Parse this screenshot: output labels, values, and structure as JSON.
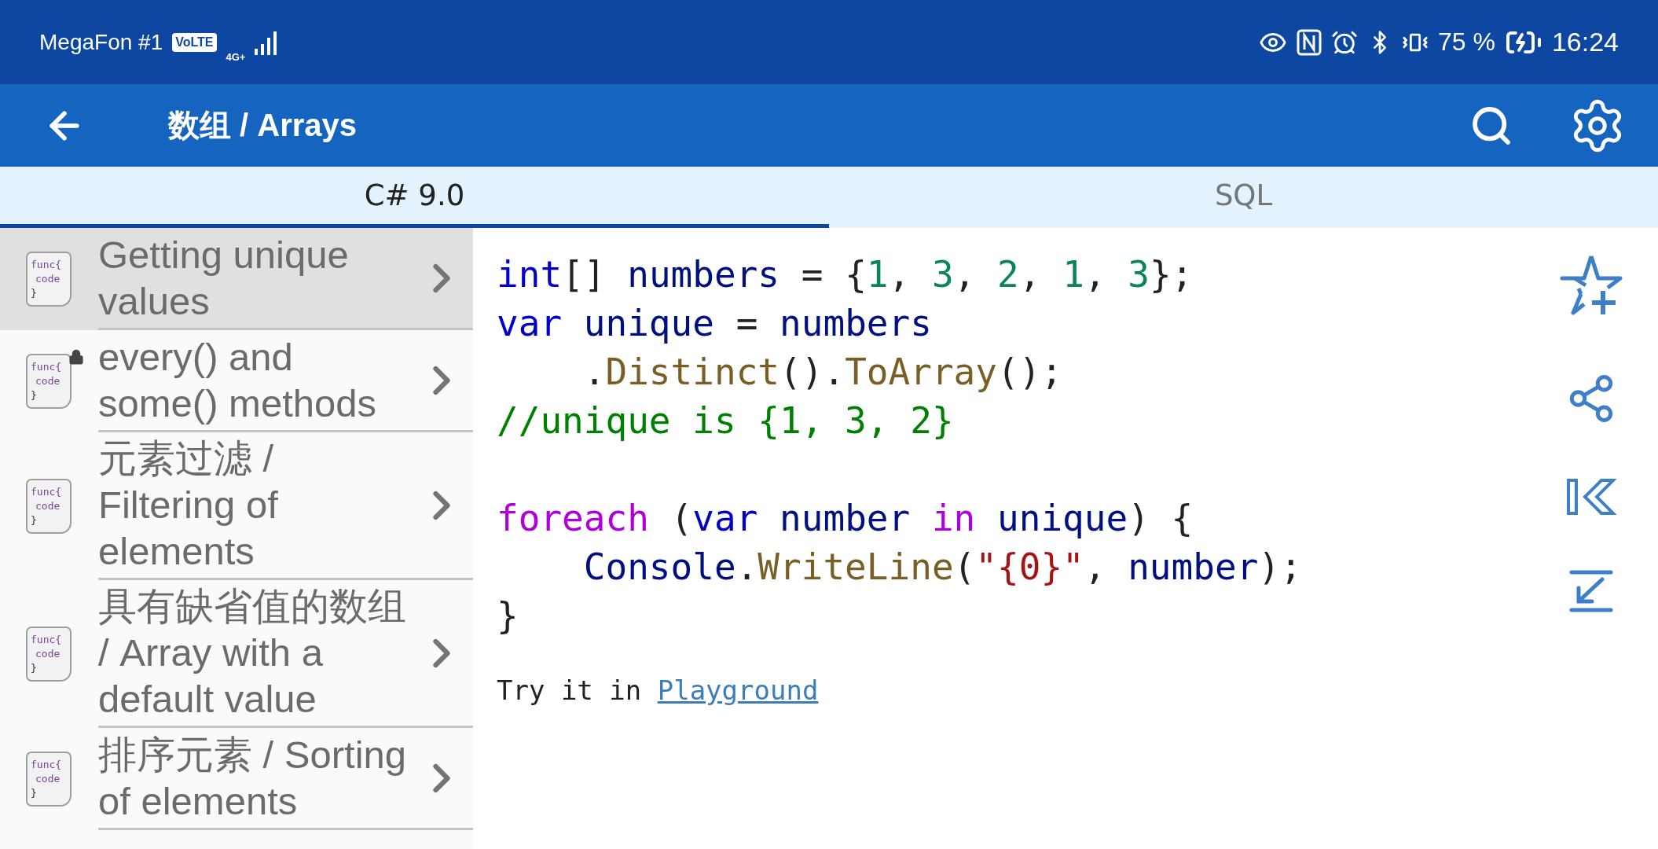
{
  "status_bar": {
    "carrier": "MegaFon #1",
    "volte": "VoLTE",
    "network": "4G+",
    "battery_percent": "75 %",
    "time": "16:24"
  },
  "app_bar": {
    "title": "数组 / Arrays"
  },
  "tabs": [
    {
      "label": "C# 9.0",
      "selected": true
    },
    {
      "label": "SQL",
      "selected": false
    }
  ],
  "topics": [
    {
      "title": "Getting unique values",
      "selected": true,
      "locked": false,
      "icon_lines": [
        "func{",
        "code",
        "}"
      ]
    },
    {
      "title": "every() and some() methods",
      "selected": false,
      "locked": true,
      "icon_lines": [
        "func{",
        "code",
        "}"
      ]
    },
    {
      "title": "元素过滤 / Filtering of elements",
      "selected": false,
      "locked": false,
      "icon_lines": [
        "func{",
        "code",
        "}"
      ]
    },
    {
      "title": "具有缺省值的数组 / Array with a default value",
      "selected": false,
      "locked": false,
      "icon_lines": [
        "func{",
        "code",
        "}"
      ]
    },
    {
      "title": "排序元素 / Sorting of elements",
      "selected": false,
      "locked": false,
      "icon_lines": [
        "func{",
        "code",
        "}"
      ]
    }
  ],
  "code": [
    {
      "indented": false,
      "gap_before": false,
      "tokens": [
        {
          "kind": "keyword",
          "text": "int"
        },
        {
          "kind": "plain",
          "text": "[] "
        },
        {
          "kind": "variable",
          "text": "numbers"
        },
        {
          "kind": "plain",
          "text": " = {"
        },
        {
          "kind": "number",
          "text": "1"
        },
        {
          "kind": "plain",
          "text": ", "
        },
        {
          "kind": "number",
          "text": "3"
        },
        {
          "kind": "plain",
          "text": ", "
        },
        {
          "kind": "number",
          "text": "2"
        },
        {
          "kind": "plain",
          "text": ", "
        },
        {
          "kind": "number",
          "text": "1"
        },
        {
          "kind": "plain",
          "text": ", "
        },
        {
          "kind": "number",
          "text": "3"
        },
        {
          "kind": "plain",
          "text": "};"
        }
      ]
    },
    {
      "indented": false,
      "gap_before": false,
      "tokens": [
        {
          "kind": "keyword",
          "text": "var"
        },
        {
          "kind": "variable",
          "text": " unique"
        },
        {
          "kind": "plain",
          "text": " = "
        },
        {
          "kind": "variable",
          "text": "numbers"
        }
      ]
    },
    {
      "indented": true,
      "gap_before": false,
      "tokens": [
        {
          "kind": "plain",
          "text": "."
        },
        {
          "kind": "method",
          "text": "Distinct"
        },
        {
          "kind": "plain",
          "text": "()."
        },
        {
          "kind": "method",
          "text": "ToArray"
        },
        {
          "kind": "plain",
          "text": "();"
        }
      ]
    },
    {
      "indented": false,
      "gap_before": false,
      "tokens": [
        {
          "kind": "comment",
          "text": "//unique is {1, 3, 2}"
        }
      ]
    },
    {
      "indented": false,
      "gap_before": true,
      "tokens": [
        {
          "kind": "control",
          "text": "foreach"
        },
        {
          "kind": "plain",
          "text": " ("
        },
        {
          "kind": "keyword",
          "text": "var"
        },
        {
          "kind": "variable",
          "text": " number"
        },
        {
          "kind": "control",
          "text": " in"
        },
        {
          "kind": "variable",
          "text": " unique"
        },
        {
          "kind": "plain",
          "text": ") {"
        }
      ]
    },
    {
      "indented": true,
      "gap_before": false,
      "tokens": [
        {
          "kind": "variable",
          "text": "Console"
        },
        {
          "kind": "plain",
          "text": "."
        },
        {
          "kind": "method",
          "text": "WriteLine"
        },
        {
          "kind": "plain",
          "text": "("
        },
        {
          "kind": "string",
          "text": "\"{0}\""
        },
        {
          "kind": "plain",
          "text": ", "
        },
        {
          "kind": "variable",
          "text": "number"
        },
        {
          "kind": "plain",
          "text": ");"
        }
      ]
    },
    {
      "indented": false,
      "gap_before": false,
      "tokens": [
        {
          "kind": "plain",
          "text": "}"
        }
      ]
    }
  ],
  "try_it": {
    "text": "Try it in ",
    "link": "Playground"
  }
}
